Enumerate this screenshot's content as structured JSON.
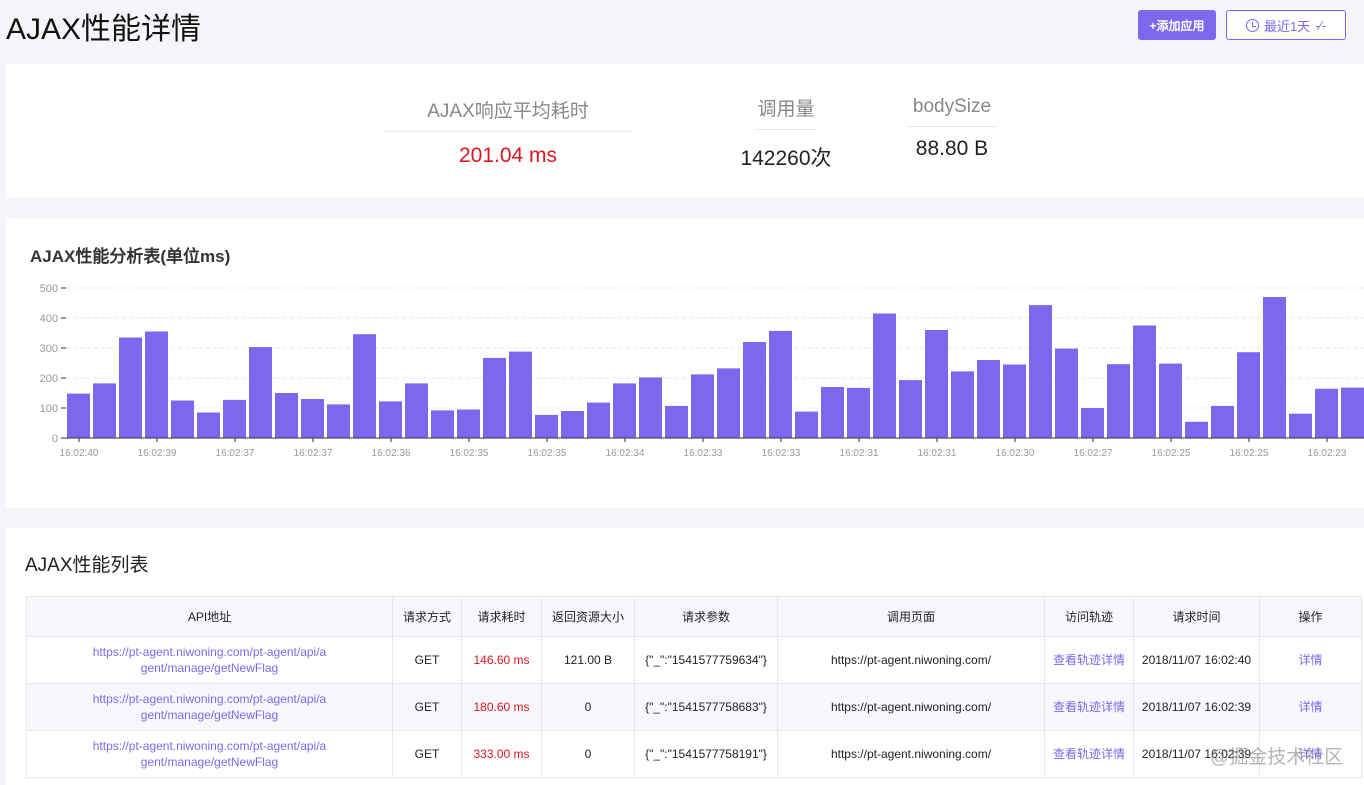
{
  "header": {
    "title": "AJAX性能详情",
    "add_app": "+添加应用",
    "range": "最近1天"
  },
  "stats": [
    {
      "label": "AJAX响应平均耗时",
      "value": "201.04 ms",
      "color": "#e0161e"
    },
    {
      "label": "调用量",
      "value": "142260次"
    },
    {
      "label": "bodySize",
      "value": "88.80 B"
    }
  ],
  "chart_data": {
    "type": "bar",
    "title": "AJAX性能分析表(单位ms)",
    "ylim": [
      0,
      500
    ],
    "yticks": [
      0,
      100,
      200,
      300,
      400,
      500
    ],
    "grid": true,
    "color": "#7b68ee",
    "values": [
      148,
      182,
      335,
      355,
      125,
      85,
      127,
      303,
      150,
      130,
      112,
      346,
      122,
      182,
      92,
      95,
      267,
      288,
      77,
      90,
      118,
      182,
      202,
      107,
      212,
      232,
      320,
      357,
      88,
      170,
      167,
      415,
      193,
      360,
      222,
      260,
      245,
      443,
      298,
      100,
      246,
      375,
      248,
      54,
      107,
      286,
      470,
      81,
      164,
      168
    ],
    "tick_labels": [
      "16:02:40",
      "16:02:39",
      "16:02:37",
      "16:02:37",
      "16:02:36",
      "16:02:35",
      "16:02:35",
      "16:02:34",
      "16:02:33",
      "16:02:33",
      "16:02:31",
      "16:02:31",
      "16:02:30",
      "16:02:27",
      "16:02:25",
      "16:02:25",
      "16:02:23"
    ]
  },
  "table": {
    "title": "AJAX性能列表",
    "headers": [
      "API地址",
      "请求方式",
      "请求耗时",
      "返回资源大小",
      "请求参数",
      "调用页面",
      "访问轨迹",
      "请求时间",
      "操作"
    ],
    "rows": [
      {
        "api": "https://pt-agent.niwoning.com/pt-agent/api/agent/manage/getNewFlag",
        "method": "GET",
        "time": "146.60 ms",
        "size": "121.00 B",
        "params": "{\"_\":\"1541577759634\"}",
        "page": "https://pt-agent.niwoning.com/",
        "trace": "查看轨迹详情",
        "date": "2018/11/07 16:02:40",
        "op": "详情"
      },
      {
        "api": "https://pt-agent.niwoning.com/pt-agent/api/agent/manage/getNewFlag",
        "method": "GET",
        "time": "180.60 ms",
        "size": "0",
        "params": "{\"_\":\"1541577758683\"}",
        "page": "https://pt-agent.niwoning.com/",
        "trace": "查看轨迹详情",
        "date": "2018/11/07 16:02:39",
        "op": "详情"
      },
      {
        "api": "https://pt-agent.niwoning.com/pt-agent/api/agent/manage/getNewFlag",
        "method": "GET",
        "time": "333.00 ms",
        "size": "0",
        "params": "{\"_\":\"1541577758191\"}",
        "page": "https://pt-agent.niwoning.com/",
        "trace": "查看轨迹详情",
        "date": "2018/11/07 16:02:39",
        "op": "详情"
      }
    ]
  },
  "watermark": "@掘金技术社区"
}
